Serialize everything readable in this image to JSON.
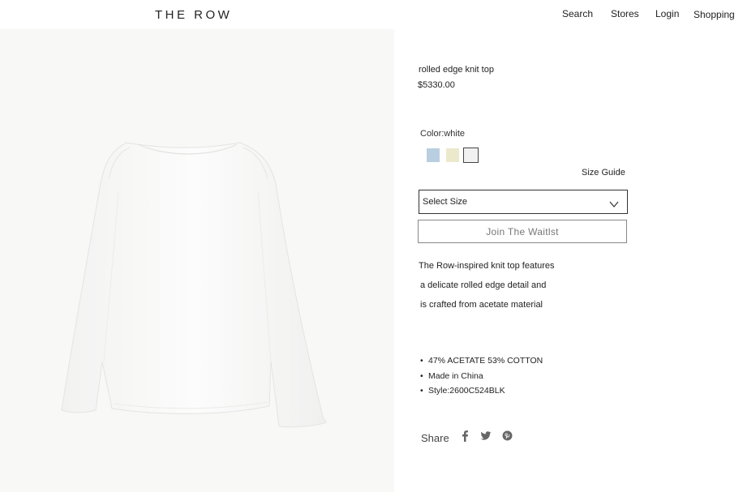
{
  "header": {
    "logo": "THE ROW",
    "nav": {
      "search": "Search",
      "stores": "Stores",
      "login": "Login",
      "shopping": "Shopping"
    }
  },
  "product": {
    "title": "rolled edge knit top",
    "price": "$5330.00",
    "color_label": "Color:white",
    "swatches": [
      {
        "name": "blue",
        "color": "#b9cfe0"
      },
      {
        "name": "cream",
        "color": "#ece8cc"
      },
      {
        "name": "white",
        "color": "#f1f1f1",
        "selected": true
      }
    ],
    "size_guide": "Size Guide",
    "size_select": "Select Size",
    "waitlist_button": "Join  The Waitlst",
    "description_lines": [
      "The Row-inspired knit top features",
      "a delicate rolled edge detail and",
      "is crafted from acetate material"
    ],
    "specs": [
      "47% ACETATE 53% COTTON",
      "Made in China",
      "Style:2600C524BLK"
    ],
    "share_label": "Share",
    "social_icons": [
      "facebook-icon",
      "twitter-icon",
      "pinterest-icon"
    ]
  }
}
